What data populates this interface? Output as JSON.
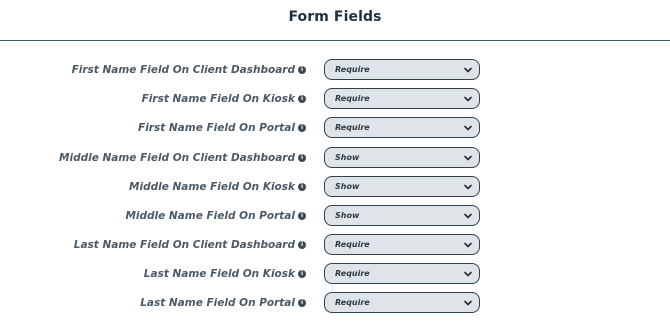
{
  "header": {
    "title": "Form Fields"
  },
  "fields": [
    {
      "label": "First Name Field On Client Dashboard",
      "value": "Require",
      "info_icon": "info-icon"
    },
    {
      "label": "First Name Field On Kiosk",
      "value": "Require",
      "info_icon": "info-icon"
    },
    {
      "label": "First Name Field On Portal",
      "value": "Require",
      "info_icon": "info-icon"
    },
    {
      "label": "Middle Name Field On Client Dashboard",
      "value": "Show",
      "info_icon": "info-icon"
    },
    {
      "label": "Middle Name Field On Kiosk",
      "value": "Show",
      "info_icon": "info-icon"
    },
    {
      "label": "Middle Name Field On Portal",
      "value": "Show",
      "info_icon": "info-icon"
    },
    {
      "label": "Last Name Field On Client Dashboard",
      "value": "Require",
      "info_icon": "info-icon"
    },
    {
      "label": "Last Name Field On Kiosk",
      "value": "Require",
      "info_icon": "info-icon"
    },
    {
      "label": "Last Name Field On Portal",
      "value": "Require",
      "info_icon": "info-icon"
    }
  ],
  "colors": {
    "title": "#1f3140",
    "label": "#4b5a66",
    "select_bg": "#dfe4e8",
    "select_border": "#2f4250"
  }
}
